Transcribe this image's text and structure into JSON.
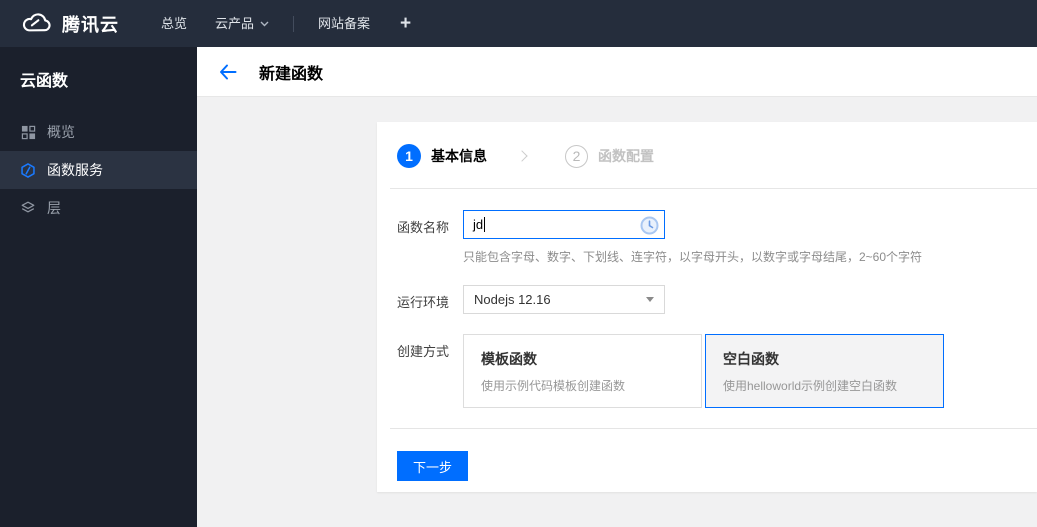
{
  "topbar": {
    "brand": "腾讯云",
    "nav": [
      {
        "label": "总览"
      },
      {
        "label": "云产品",
        "has_caret": true
      },
      {
        "label": "网站备案"
      },
      {
        "label": "+"
      }
    ]
  },
  "sidebar": {
    "title": "云函数",
    "items": [
      {
        "label": "概览",
        "icon": "grid-icon",
        "selected": false
      },
      {
        "label": "函数服务",
        "icon": "function-hexagon-icon",
        "selected": true
      },
      {
        "label": "层",
        "icon": "layers-icon",
        "selected": false
      }
    ]
  },
  "header": {
    "title": "新建函数",
    "back_icon": "arrow-left-icon"
  },
  "wizard": {
    "steps": [
      {
        "number": "1",
        "label": "基本信息",
        "active": true
      },
      {
        "number": "2",
        "label": "函数配置",
        "active": false
      }
    ],
    "form": {
      "name_label": "函数名称",
      "name_value": "jd",
      "name_hint": "只能包含字母、数字、下划线、连字符，以字母开头，以数字或字母结尾，2~60个字符",
      "name_field_icon": "clock-icon",
      "runtime_label": "运行环境",
      "runtime_value": "Nodejs 12.16",
      "method_label": "创建方式",
      "methods": [
        {
          "title": "模板函数",
          "desc": "使用示例代码模板创建函数",
          "selected": false
        },
        {
          "title": "空白函数",
          "desc": "使用helloworld示例创建空白函数",
          "selected": true
        }
      ]
    },
    "next_button": "下一步"
  },
  "colors": {
    "accent_blue": "#006eff",
    "topbar_bg": "#252d3c",
    "sidebar_bg": "#1b202c",
    "sidebar_selected_bg": "#2b3342",
    "content_bg": "#f1f1f2",
    "selected_card_bg": "#f3f3f4"
  }
}
